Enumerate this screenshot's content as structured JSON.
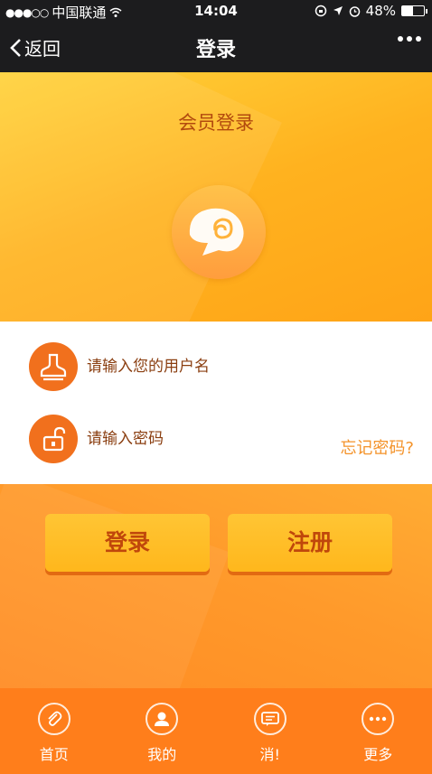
{
  "status_bar": {
    "signal": "●●●○○",
    "carrier": "中国联通",
    "time": "14:04",
    "battery": "48%",
    "battery_level": 0.48
  },
  "nav": {
    "back_label": "返回",
    "title": "登录"
  },
  "hero": {
    "title": "会员登录"
  },
  "form": {
    "username_placeholder": "请输入您的用户名",
    "password_placeholder": "请输入密码",
    "forgot_label": "忘记密码?"
  },
  "actions": {
    "login_label": "登录",
    "register_label": "注册"
  },
  "tabs": [
    {
      "label": "首页",
      "icon": "paperclip-icon"
    },
    {
      "label": "我的",
      "icon": "person-icon"
    },
    {
      "label": "消!",
      "icon": "message-icon"
    },
    {
      "label": "更多",
      "icon": "more-icon"
    }
  ]
}
